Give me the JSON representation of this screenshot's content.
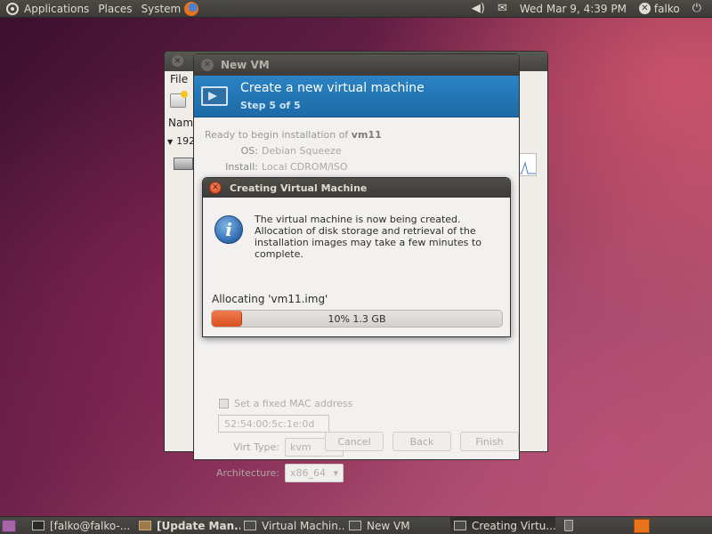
{
  "top_panel": {
    "menus": [
      "Applications",
      "Places",
      "System"
    ],
    "datetime": "Wed Mar 9, 4:39 PM",
    "user": "falko",
    "icons": [
      "ubuntu-logo-icon",
      "firefox-icon",
      "volume-icon",
      "mail-icon",
      "user-icon",
      "power-icon"
    ]
  },
  "bg_window": {
    "menu_file": "File",
    "column_header": "Nam",
    "host": "192."
  },
  "new_vm": {
    "title": "New VM",
    "header_title": "Create a new virtual machine",
    "header_step": "Step 5 of 5",
    "ready_prefix": "Ready to begin installation of ",
    "vm_name": "vm11",
    "os_label": "OS:",
    "os_value": "Debian Squeeze",
    "install_label": "Install:",
    "install_value": "Local CDROM/ISO",
    "mac_checkbox_label": "Set a fixed MAC address",
    "mac_value": "52:54:00:5c:1e:0d",
    "virt_type_label": "Virt Type:",
    "virt_type_value": "kvm",
    "architecture_label": "Architecture:",
    "architecture_value": "x86_64",
    "buttons": {
      "cancel": "Cancel",
      "back": "Back",
      "finish": "Finish"
    }
  },
  "creating_dialog": {
    "title": "Creating Virtual Machine",
    "message": "The virtual machine is now being created. Allocation of disk storage and retrieval of the installation images may take a few minutes to complete.",
    "allocating_label": "Allocating 'vm11.img'",
    "progress_text": "10% 1.3 GB",
    "progress_fraction": 0.1
  },
  "taskbar": {
    "tasks": [
      {
        "label": "[falko@falko-...",
        "icon": "terminal-icon"
      },
      {
        "label": "[Update Man...",
        "icon": "update-manager-icon"
      },
      {
        "label": "Virtual Machin...",
        "icon": "virt-manager-icon"
      },
      {
        "label": "New VM",
        "icon": "virt-manager-icon"
      },
      {
        "label": "Creating Virtu...",
        "icon": "virt-manager-icon"
      }
    ]
  }
}
